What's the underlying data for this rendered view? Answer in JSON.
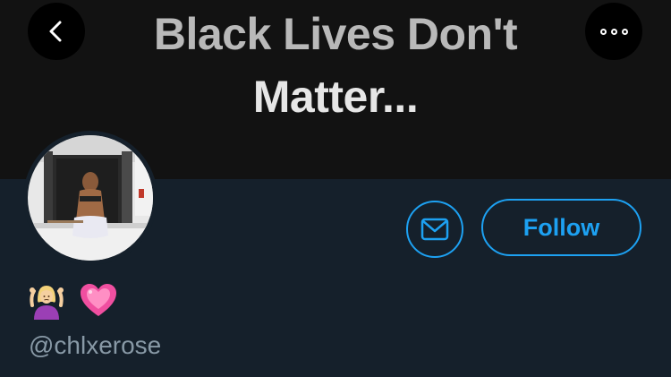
{
  "banner": {
    "line1": "Black Lives Don't",
    "line2": "Matter..."
  },
  "header": {
    "back_icon": "chevron-left-icon",
    "more_icon": "more-horizontal-icon"
  },
  "profile": {
    "avatar_icon": "avatar-photo",
    "bio_emojis": [
      "person-shrugging-icon",
      "sparkling-heart-icon"
    ],
    "handle": "@chlxerose"
  },
  "actions": {
    "message_icon": "envelope-icon",
    "follow_label": "Follow"
  },
  "colors": {
    "background": "#15202b",
    "accent": "#1da1f2",
    "secondary_text": "#8899a6"
  }
}
